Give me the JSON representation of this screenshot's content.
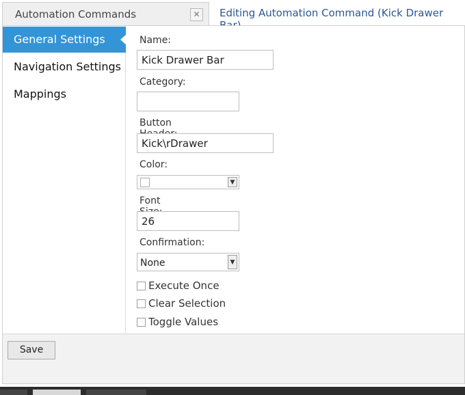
{
  "tab": {
    "label": "Automation Commands",
    "close_glyph": "✕"
  },
  "page_title": "Editing Automation Command (Kick Drawer Bar)",
  "sidebar": {
    "items": [
      {
        "label": "General Settings",
        "active": true
      },
      {
        "label": "Navigation Settings",
        "active": false
      },
      {
        "label": "Mappings",
        "active": false
      }
    ]
  },
  "form": {
    "name": {
      "label": "Name:",
      "value": "Kick Drawer Bar"
    },
    "category": {
      "label": "Category:",
      "value": ""
    },
    "button_header": {
      "label": "Button Header:",
      "value": "Kick\\rDrawer"
    },
    "color": {
      "label": "Color:",
      "value": ""
    },
    "font_size": {
      "label": "Font Size:",
      "value": "26"
    },
    "confirmation": {
      "label": "Confirmation:",
      "value": "None"
    },
    "checkboxes": [
      {
        "label": "Execute Once",
        "checked": false
      },
      {
        "label": "Clear Selection",
        "checked": false
      },
      {
        "label": "Toggle Values",
        "checked": false
      }
    ]
  },
  "footer": {
    "save_label": "Save"
  },
  "colors": {
    "accent": "#3394d6",
    "title": "#2b5797"
  }
}
